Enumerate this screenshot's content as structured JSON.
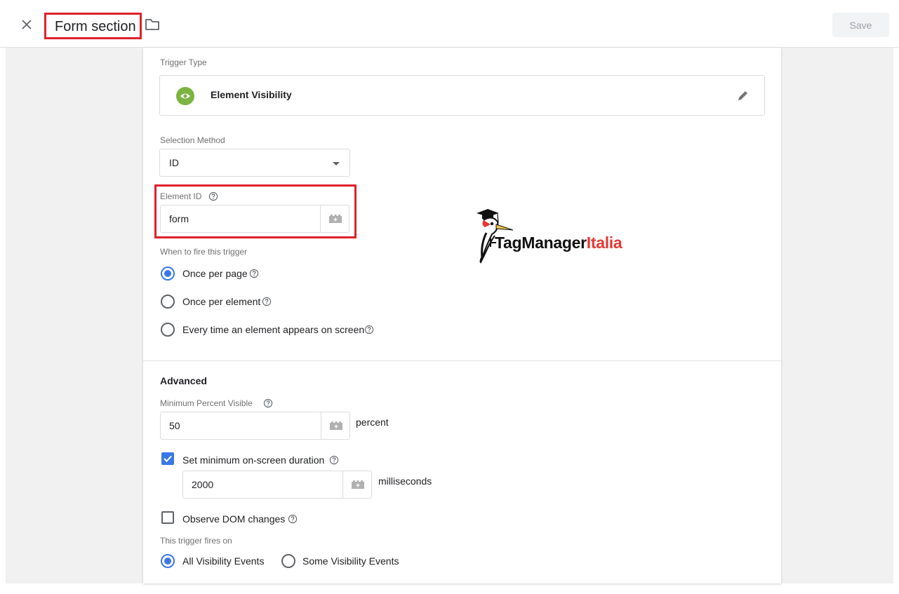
{
  "header": {
    "title": "Form section",
    "save_label": "Save"
  },
  "trigger_type": {
    "label": "Trigger Type",
    "name": "Element Visibility",
    "icon": "eye-icon",
    "icon_color": "#7cb342"
  },
  "selection_method": {
    "label": "Selection Method",
    "value": "ID"
  },
  "element_id": {
    "label": "Element ID",
    "value": "form"
  },
  "fire_when": {
    "label": "When to fire this trigger",
    "options": [
      {
        "label": "Once per page",
        "selected": true
      },
      {
        "label": "Once per element",
        "selected": false
      },
      {
        "label": "Every time an element appears on screen",
        "selected": false
      }
    ]
  },
  "advanced": {
    "title": "Advanced",
    "min_percent": {
      "label": "Minimum Percent Visible",
      "value": "50",
      "unit": "percent"
    },
    "min_duration": {
      "checkbox_label": "Set minimum on-screen duration",
      "checked": true,
      "value": "2000",
      "unit": "milliseconds"
    },
    "observe_dom": {
      "label": "Observe DOM changes",
      "checked": false
    },
    "fires_on": {
      "label": "This trigger fires on",
      "options": [
        {
          "label": "All Visibility Events",
          "selected": true
        },
        {
          "label": "Some Visibility Events",
          "selected": false
        }
      ]
    }
  },
  "watermark": {
    "part1": "TagManager",
    "part2": "Italia"
  },
  "colors": {
    "accent": "#3b78e7",
    "highlight": "#e0202a"
  }
}
